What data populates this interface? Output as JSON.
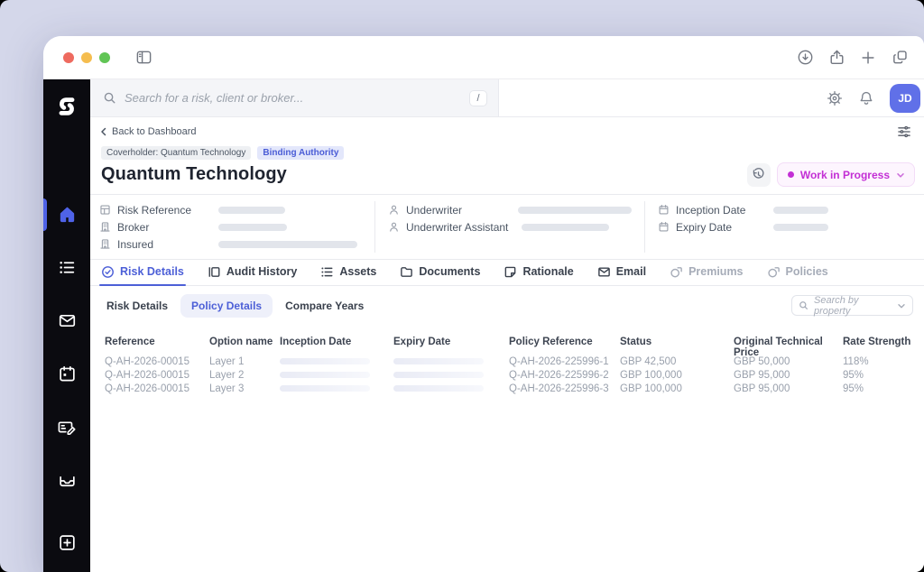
{
  "colors": {
    "accent_indigo": "#4c5fd7",
    "status_fuchsia": "#c32fd5",
    "avatar_bg": "#6070e8",
    "sidebar_bg": "#0b0b10",
    "badge_indigo_bg": "#e3e7fb",
    "canvas": "#d4d7ea",
    "active_nav": "#4f63e8"
  },
  "icons": {
    "traffic": "red/yellow/green dots",
    "sidebar_toggle": "panel outline",
    "download": "circle arrow down",
    "share": "box arrow up",
    "new_tab": "plus",
    "tab_overview": "stacked squares",
    "logo": "S mark",
    "home": "house",
    "risks": "bulleted list",
    "mail": "envelope",
    "calendar": "calendar",
    "quotes": "card with pencil",
    "inbox": "tray",
    "create": "plus square",
    "search": "magnifier",
    "gear": "gear",
    "bell": "bell",
    "filter": "sliders",
    "back": "chevron left",
    "history": "clock ccw arrow",
    "chevron_down": "chevron down",
    "risk_details": "badge check",
    "audit": "bar panel",
    "assets": "list",
    "documents": "folder",
    "rationale": "note",
    "email": "envelope",
    "premiums": "coin",
    "policies": "coin",
    "ref_field": "ledger",
    "company": "building",
    "person": "user",
    "date": "calendar"
  },
  "topbar": {
    "search_placeholder": "Search for a risk, client or broker...",
    "shortcut_key": "/",
    "avatar_initials": "JD"
  },
  "breadcrumb": {
    "back_label": "Back to Dashboard"
  },
  "header": {
    "coverholder_badge": "Coverholder: Quantum Technology",
    "type_badge": "Binding Authority",
    "title": "Quantum Technology",
    "status_label": "Work in Progress"
  },
  "summary": {
    "left": [
      {
        "label": "Risk Reference"
      },
      {
        "label": "Broker"
      },
      {
        "label": "Insured"
      }
    ],
    "middle": [
      {
        "label": "Underwriter"
      },
      {
        "label": "Underwriter Assistant"
      }
    ],
    "right": [
      {
        "label": "Inception Date"
      },
      {
        "label": "Expiry Date"
      }
    ]
  },
  "tabs": [
    {
      "label": "Risk Details",
      "state": "active"
    },
    {
      "label": "Audit History",
      "state": "normal"
    },
    {
      "label": "Assets",
      "state": "normal"
    },
    {
      "label": "Documents",
      "state": "normal"
    },
    {
      "label": "Rationale",
      "state": "normal"
    },
    {
      "label": "Email",
      "state": "normal"
    },
    {
      "label": "Premiums",
      "state": "disabled"
    },
    {
      "label": "Policies",
      "state": "disabled"
    }
  ],
  "subtabs": [
    {
      "label": "Risk Details",
      "state": "normal"
    },
    {
      "label": "Policy Details",
      "state": "active"
    },
    {
      "label": "Compare Years",
      "state": "normal"
    }
  ],
  "property_search": {
    "placeholder": "Search by property"
  },
  "table": {
    "columns": [
      "Reference",
      "Option name",
      "Inception Date",
      "Expiry Date",
      "Policy Reference",
      "Status",
      "Original Technical Price",
      "Rate Strength"
    ],
    "rows": [
      {
        "reference": "Q-AH-2026-00015",
        "option": "Layer 1",
        "policy_ref": "Q-AH-2026-225996-1",
        "status": "GBP 42,500",
        "otp": "GBP 50,000",
        "rate": "118%"
      },
      {
        "reference": "Q-AH-2026-00015",
        "option": "Layer 2",
        "policy_ref": "Q-AH-2026-225996-2",
        "status": "GBP 100,000",
        "otp": "GBP 95,000",
        "rate": "95%"
      },
      {
        "reference": "Q-AH-2026-00015",
        "option": "Layer 3",
        "policy_ref": "Q-AH-2026-225996-3",
        "status": "GBP 100,000",
        "otp": "GBP 95,000",
        "rate": "95%"
      }
    ]
  }
}
